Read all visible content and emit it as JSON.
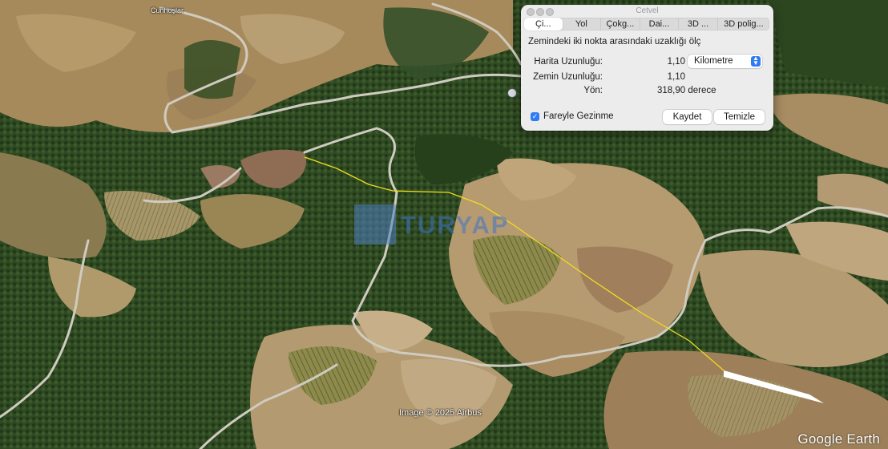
{
  "map": {
    "village_label": "Cunhoşlar",
    "credit": "Image © 2025 Airbus",
    "brand": "Google Earth",
    "watermark_text": "TURYAP"
  },
  "ruler": {
    "title": "Cetvel",
    "tabs": [
      "Çi...",
      "Yol",
      "Çokg...",
      "Dai...",
      "3D ...",
      "3D polig..."
    ],
    "active_tab": 0,
    "description": "Zemindeki iki nokta arasındaki uzaklığı ölç",
    "map_length_label": "Harita Uzunluğu:",
    "map_length_value": "1,10",
    "unit_selected": "Kilometre",
    "ground_length_label": "Zemin Uzunluğu:",
    "ground_length_value": "1,10",
    "heading_label": "Yön:",
    "heading_value": "318,90 derece",
    "mouse_nav_label": "Fareyle Gezinme",
    "mouse_nav_checked": true,
    "save_label": "Kaydet",
    "clear_label": "Temizle"
  },
  "colors": {
    "measure_line": "#f2dd1e",
    "accent": "#2f7bf5",
    "road": "#cfcbc0"
  }
}
